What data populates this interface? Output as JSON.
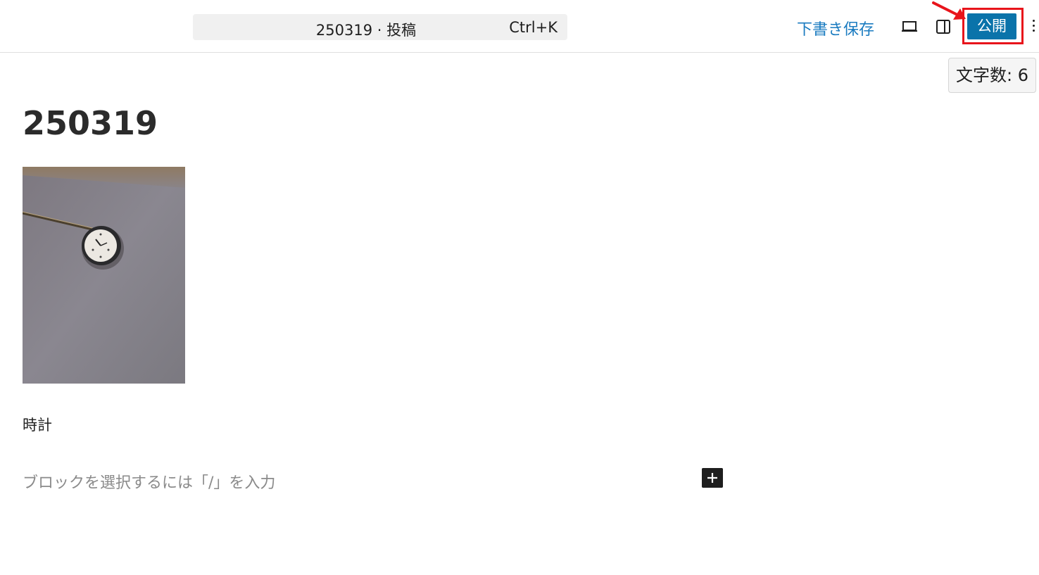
{
  "header": {
    "command_title": "250319 · 投稿",
    "command_shortcut": "Ctrl+K",
    "save_draft_label": "下書き保存",
    "publish_label": "公開",
    "accent_color": "#0a73aa",
    "link_color": "#1a7bc0",
    "highlight_color": "#e8141b",
    "icons": [
      "preview-icon",
      "sidebar-toggle-icon",
      "more-options-icon"
    ]
  },
  "word_count": {
    "label": "文字数: 6"
  },
  "post": {
    "title": "250319",
    "image_icon": "wall-clock-photo",
    "paragraph": "時計",
    "block_placeholder": "ブロックを選択するには「/」を入力"
  }
}
